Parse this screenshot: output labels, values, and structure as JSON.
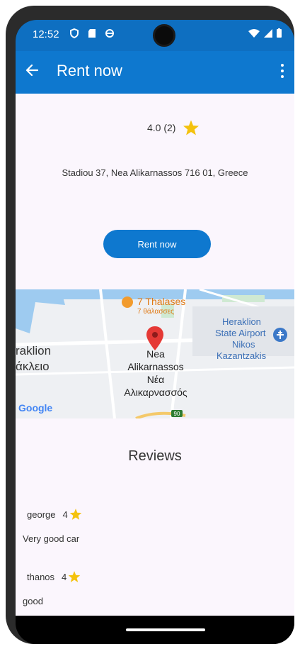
{
  "status": {
    "time": "12:52",
    "left_icons": [
      "shield-icon",
      "sd-card-icon",
      "sync-icon"
    ],
    "right_icons": [
      "wifi-icon",
      "signal-icon",
      "battery-icon"
    ]
  },
  "appbar": {
    "title": "Rent now",
    "back_icon": "arrow-left-icon",
    "menu_icon": "more-vert-icon"
  },
  "rating": {
    "text": "4.0 (2)",
    "star_color": "#f4c20d"
  },
  "address": "Stadiou 37, Nea Alikarnassos 716 01, Greece",
  "rent_button": {
    "label": "Rent now"
  },
  "map": {
    "place_labels": {
      "restaurant_en": "7 Thalases",
      "restaurant_gr": "7 θάλασσες",
      "city_en": "raklion",
      "city_gr": "άκλειο",
      "neighborhood_en_1": "Nea",
      "neighborhood_en_2": "Alikarnassos",
      "neighborhood_gr_1": "Νέα",
      "neighborhood_gr_2": "Αλικαρνασσός",
      "airport_1": "Heraklion",
      "airport_2": "State Airport",
      "airport_3": "Nikos",
      "airport_4": "Kazantzakis",
      "road_shield": "90"
    },
    "logo_text": "Google",
    "marker_color": "#e53935"
  },
  "reviews": {
    "title": "Reviews",
    "items": [
      {
        "name": "george",
        "rating": "4",
        "text": "Very good car"
      },
      {
        "name": "thanos",
        "rating": "4",
        "text": "good"
      }
    ]
  },
  "colors": {
    "primary": "#0e78cf",
    "status_bar": "#0e6fc1",
    "background": "#fbf6fd",
    "star": "#f4c20d"
  }
}
